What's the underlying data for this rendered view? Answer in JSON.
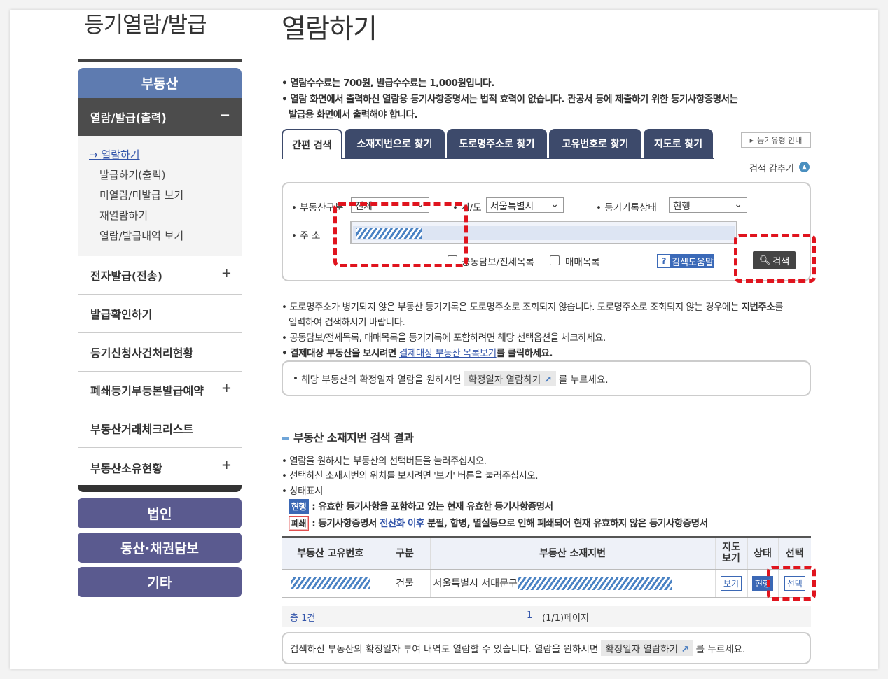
{
  "sidebar": {
    "title": "등기열람/발급",
    "main_category": "부동산",
    "open_item": "열람/발급(출력)",
    "open_item_toggle": "−",
    "sub_items": [
      "열람하기",
      "발급하기(출력)",
      "미열람/미발급 보기",
      "재열람하기",
      "열람/발급내역 보기"
    ],
    "items": [
      {
        "label": "전자발급(전송)",
        "toggle": "+"
      },
      {
        "label": "발급확인하기",
        "toggle": ""
      },
      {
        "label": "등기신청사건처리현황",
        "toggle": ""
      },
      {
        "label": "폐쇄등기부등본발급예약",
        "toggle": "+"
      },
      {
        "label": "부동산거래체크리스트",
        "toggle": ""
      },
      {
        "label": "부동산소유현황",
        "toggle": "+"
      }
    ],
    "bottom_categories": [
      "법인",
      "동산·채권담보",
      "기타"
    ]
  },
  "main": {
    "title": "열람하기",
    "notes": [
      "열람수수료는 700원, 발급수수료는 1,000원입니다.",
      "열람 화면에서 출력하신 열람용 등기사항증명서는 법적 효력이 없습니다. 관공서 등에 제출하기 위한 등기사항증명서는",
      "발급용 화면에서 출력해야 합니다."
    ],
    "tabs": [
      "간편 검색",
      "소재지번으로 찾기",
      "도로명주소로 찾기",
      "고유번호로 찾기",
      "지도로 찾기"
    ],
    "guide_button": "등기유형 안내",
    "fold_label": "검색 감추기",
    "form": {
      "property_type_label": "부동산구분",
      "property_type_value": "전체",
      "sido_label": "시/도",
      "sido_value": "서울특별시",
      "status_label": "등기기록상태",
      "status_value": "현행",
      "address_label": "주 소",
      "checkbox_collateral": "공동담보/전세목록",
      "checkbox_sale": "매매목록",
      "help_button": "검색도움말",
      "search_button": "검색"
    },
    "notes2": [
      "도로명주소가 병기되지 않은 부동산 등기기록은 도로명주소로 조회되지 않습니다. 도로명주소로 조회되지 않는 경우에는 ",
      "지번주소",
      "를",
      "입력하여 검색하시기 바랍니다.",
      "공동담보/전세목록, 매매목록을 등기기록에 포함하려면 해당 선택옵션을 체크하세요.",
      "결제대상 부동산을 보시려면 ",
      "결제대상 부동산 목록보기",
      "를 클릭하세요."
    ],
    "info1": {
      "pre": "해당 부동산의 확정일자 열람을 원하시면",
      "chip": "확정일자 열람하기",
      "post": "를 누르세요."
    },
    "result": {
      "title": "부동산 소재지번 검색 결과",
      "notes": [
        "열람을 원하시는 부동산의 선택버튼을 눌러주십시오.",
        "선택하신 소재지번의 위치를 보시려면 '보기' 버튼을 눌러주십시오.",
        "상태표시"
      ],
      "legend_current_badge": "현행",
      "legend_current_text": ": 유효한 등기사항을 포함하고 있는 현재 유효한 등기사항증명서",
      "legend_closed_badge": "폐쇄",
      "legend_closed_text_a": ": 등기사항증명서 ",
      "legend_closed_text_b": "전산화 이후",
      "legend_closed_text_c": " 분필, 합병, 멸실등으로 인해 폐쇄되어 현재 유효하지 않은 등기사항증명서",
      "columns": [
        "부동산 고유번호",
        "구분",
        "부동산 소재지번",
        "지도\n보기",
        "상태",
        "선택"
      ],
      "row": {
        "type": "건물",
        "address": "서울특별시 서대문구",
        "map_button": "보기",
        "status": "현행",
        "select_button": "선택"
      },
      "total": "총 1건",
      "page_number": "1",
      "page_info": "(1/1)페이지"
    },
    "info2": {
      "pre": "검색하신 부동산의 확정일자 부여 내역도 열람할 수 있습니다. 열람을 원하시면",
      "chip": "확정일자 열람하기",
      "post": "를 누르세요."
    }
  },
  "colors": {
    "tab": "#3d4a6b",
    "category": "#5a5a8f",
    "highlight": "#e0141e"
  }
}
